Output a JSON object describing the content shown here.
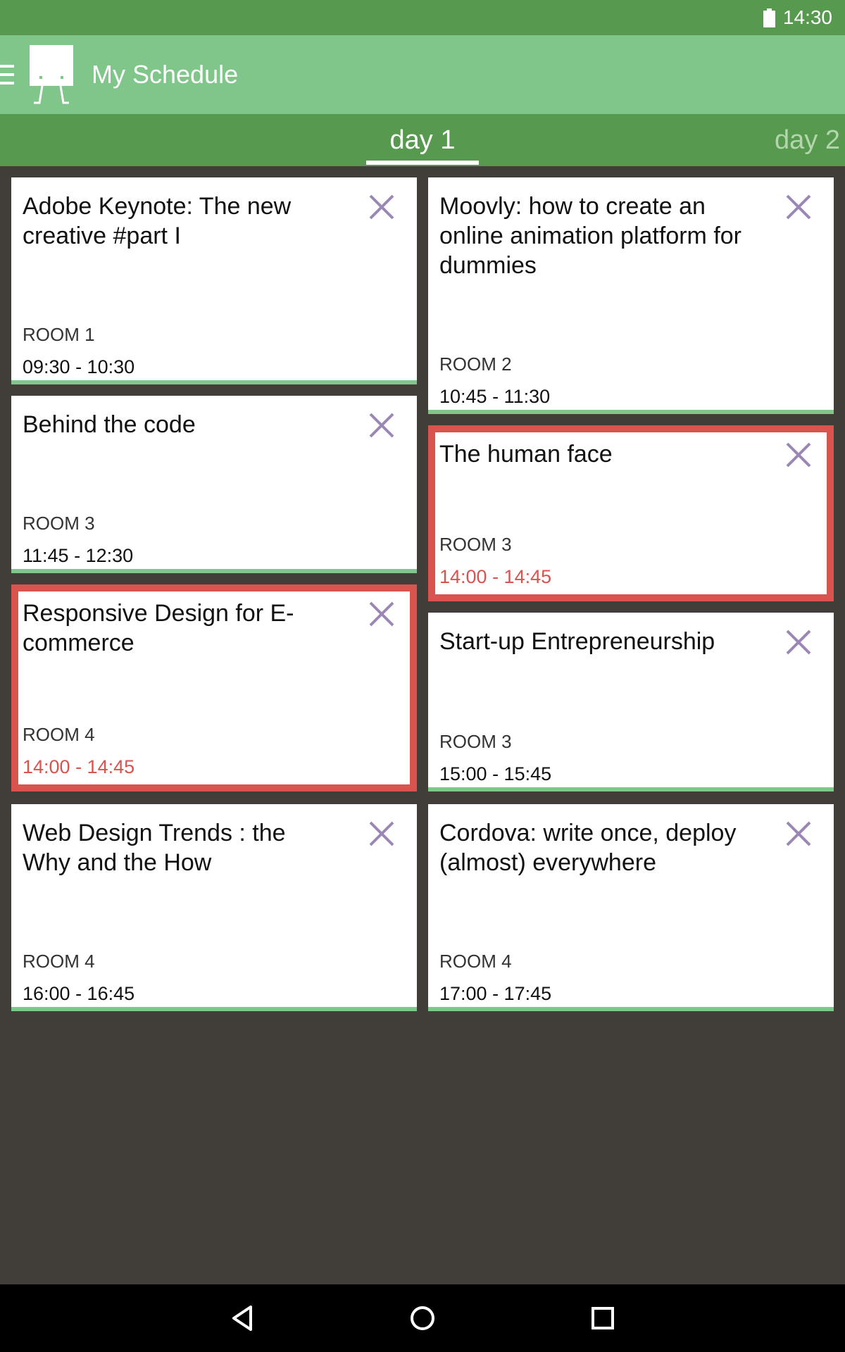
{
  "status_bar": {
    "time": "14:30",
    "icons": [
      "battery-icon"
    ]
  },
  "toolbar": {
    "title": "My Schedule",
    "icons": [
      "menu-icon",
      "app-logo-icon"
    ]
  },
  "tabs": [
    {
      "label": "day 1",
      "selected": true
    },
    {
      "label": "day 2",
      "selected": false
    }
  ],
  "sessions": [
    {
      "title": "Adobe Keynote: The new creative #part I",
      "room": "ROOM 1",
      "time": "09:30 - 10:30",
      "conflict": false
    },
    {
      "title": "Moovly: how to create an online animation platform for dummies",
      "room": "ROOM 2",
      "time": "10:45 - 11:30",
      "conflict": false
    },
    {
      "title": "Behind the code",
      "room": "ROOM 3",
      "time": "11:45 - 12:30",
      "conflict": false
    },
    {
      "title": "The human face",
      "room": "ROOM 3",
      "time": "14:00 - 14:45",
      "conflict": true
    },
    {
      "title": "Responsive Design for E-commerce",
      "room": "ROOM 4",
      "time": "14:00 - 14:45",
      "conflict": true
    },
    {
      "title": "Start-up Entrepreneurship",
      "room": "ROOM 3",
      "time": "15:00 - 15:45",
      "conflict": false
    },
    {
      "title": "Web Design Trends : the Why and the How",
      "room": "ROOM 4",
      "time": "16:00 - 16:45",
      "conflict": false
    },
    {
      "title": "Cordova: write once, deploy (almost) everywhere",
      "room": "ROOM 4",
      "time": "17:00 - 17:45",
      "conflict": false
    }
  ],
  "nav_bar": {
    "icons": [
      "back-icon",
      "home-icon",
      "recents-icon"
    ]
  },
  "colors": {
    "status_bar": "#57994f",
    "toolbar": "#80c58a",
    "background": "#413d38",
    "conflict": "#d9534f",
    "close_icon": "#9b87b5"
  }
}
